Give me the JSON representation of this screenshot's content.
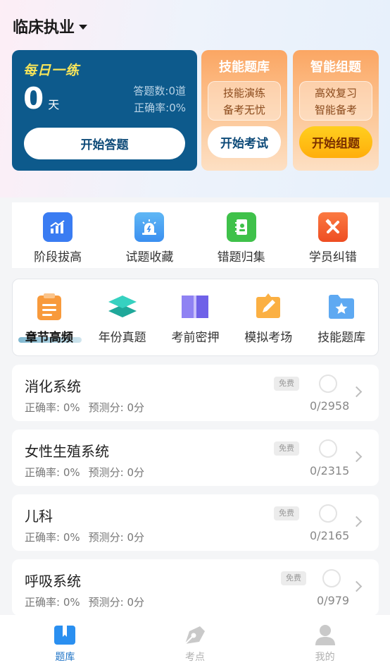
{
  "header": {
    "title": "临床执业"
  },
  "daily": {
    "title": "每日一练",
    "days": "0",
    "days_unit": "天",
    "answered": "答题数:0道",
    "accuracy": "正确率:0%",
    "button": "开始答题"
  },
  "skill_card": {
    "title": "技能题库",
    "line1": "技能演练",
    "line2": "备考无忧",
    "button": "开始考试"
  },
  "smart_card": {
    "title": "智能组题",
    "line1": "高效复习",
    "line2": "智能备考",
    "button": "开始组题"
  },
  "tools": [
    {
      "label": "阶段拔高",
      "icon": "chart-icon",
      "color": "#3a7cf2"
    },
    {
      "label": "试题收藏",
      "icon": "alarm-icon",
      "color": "#4aa3f0"
    },
    {
      "label": "错题归集",
      "icon": "notebook-icon",
      "color": "#3fc14a"
    },
    {
      "label": "学员纠错",
      "icon": "tools-icon",
      "color": "#f2602f"
    }
  ],
  "categories": [
    {
      "label": "章节高频",
      "icon": "clipboard-icon"
    },
    {
      "label": "年份真题",
      "icon": "layers-icon"
    },
    {
      "label": "考前密押",
      "icon": "book-icon"
    },
    {
      "label": "模拟考场",
      "icon": "pencil-board-icon"
    },
    {
      "label": "技能题库",
      "icon": "star-folder-icon"
    }
  ],
  "subjects": [
    {
      "name": "消化系统",
      "accuracy": "正确率: 0%",
      "predicted": "预测分: 0分",
      "badge": "免费",
      "progress": "0/2958"
    },
    {
      "name": "女性生殖系统",
      "accuracy": "正确率: 0%",
      "predicted": "预测分: 0分",
      "badge": "免费",
      "progress": "0/2315"
    },
    {
      "name": "儿科",
      "accuracy": "正确率: 0%",
      "predicted": "预测分: 0分",
      "badge": "免费",
      "progress": "0/2165"
    },
    {
      "name": "呼吸系统",
      "accuracy": "正确率: 0%",
      "predicted": "预测分: 0分",
      "badge": "免费",
      "progress": "0/979"
    }
  ],
  "nav": [
    {
      "label": "题库",
      "icon": "book-tab-icon"
    },
    {
      "label": "考点",
      "icon": "pen-nib-icon"
    },
    {
      "label": "我的",
      "icon": "profile-icon"
    }
  ]
}
